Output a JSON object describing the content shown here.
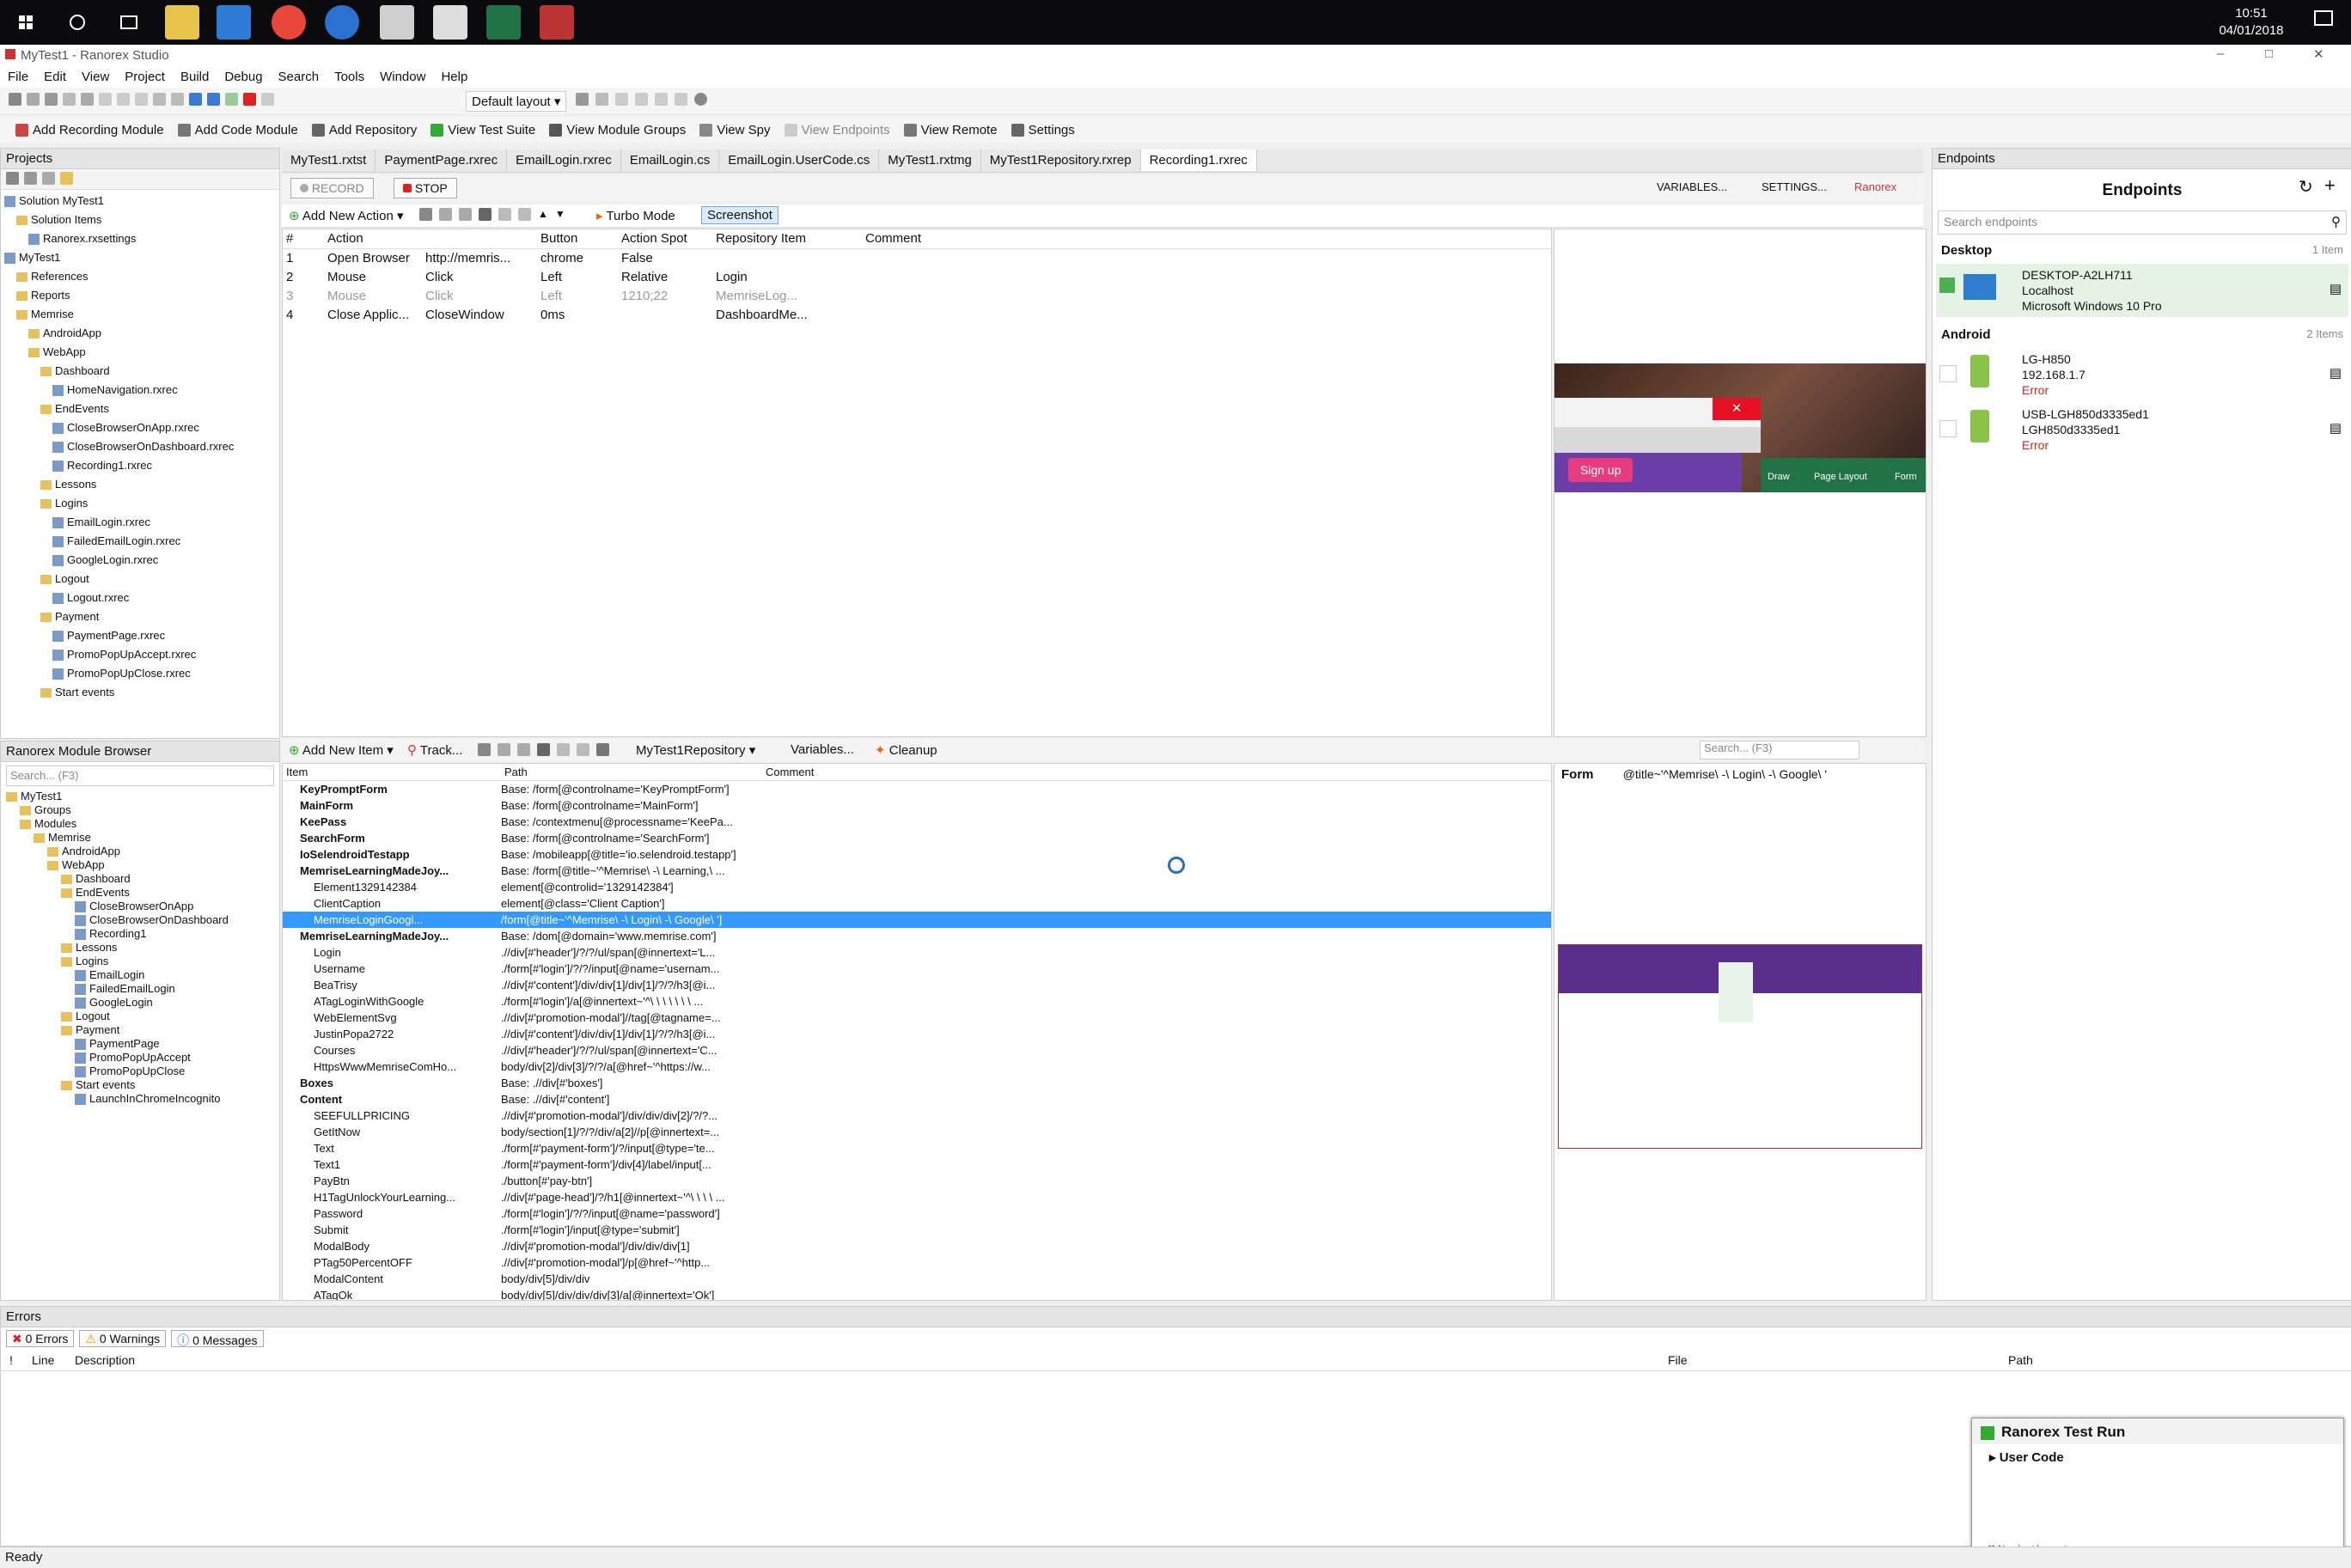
{
  "window": {
    "title": "MyTest1 - Ranorex Studio"
  },
  "taskbar": {
    "time": "10:51",
    "date": "04/01/2018"
  },
  "menu": [
    "File",
    "Edit",
    "View",
    "Project",
    "Build",
    "Debug",
    "Search",
    "Tools",
    "Window",
    "Help"
  ],
  "toolbar": {
    "layout": "Default layout"
  },
  "toolbar2": {
    "add_recording": "Add Recording Module",
    "add_code": "Add Code Module",
    "add_repo": "Add Repository",
    "view_suite": "View Test Suite",
    "view_groups": "View Module Groups",
    "view_spy": "View Spy",
    "view_endpoints": "View Endpoints",
    "view_remote": "View Remote",
    "settings": "Settings"
  },
  "projects": {
    "title": "Projects",
    "items": [
      {
        "label": "Solution MyTest1",
        "lvl": 0,
        "type": "f"
      },
      {
        "label": "Solution Items",
        "lvl": 1,
        "type": "d"
      },
      {
        "label": "Ranorex.rxsettings",
        "lvl": 2,
        "type": "f"
      },
      {
        "label": "MyTest1",
        "lvl": 0,
        "type": "f"
      },
      {
        "label": "References",
        "lvl": 1,
        "type": "d"
      },
      {
        "label": "Reports",
        "lvl": 1,
        "type": "d"
      },
      {
        "label": "Memrise",
        "lvl": 1,
        "type": "d"
      },
      {
        "label": "AndroidApp",
        "lvl": 2,
        "type": "d"
      },
      {
        "label": "WebApp",
        "lvl": 2,
        "type": "d"
      },
      {
        "label": "Dashboard",
        "lvl": 3,
        "type": "d"
      },
      {
        "label": "HomeNavigation.rxrec",
        "lvl": 4,
        "type": "f"
      },
      {
        "label": "EndEvents",
        "lvl": 3,
        "type": "d"
      },
      {
        "label": "CloseBrowserOnApp.rxrec",
        "lvl": 4,
        "type": "f"
      },
      {
        "label": "CloseBrowserOnDashboard.rxrec",
        "lvl": 4,
        "type": "f"
      },
      {
        "label": "Recording1.rxrec",
        "lvl": 4,
        "type": "f"
      },
      {
        "label": "Lessons",
        "lvl": 3,
        "type": "d"
      },
      {
        "label": "Logins",
        "lvl": 3,
        "type": "d"
      },
      {
        "label": "EmailLogin.rxrec",
        "lvl": 4,
        "type": "f"
      },
      {
        "label": "FailedEmailLogin.rxrec",
        "lvl": 4,
        "type": "f"
      },
      {
        "label": "GoogleLogin.rxrec",
        "lvl": 4,
        "type": "f"
      },
      {
        "label": "Logout",
        "lvl": 3,
        "type": "d"
      },
      {
        "label": "Logout.rxrec",
        "lvl": 4,
        "type": "f"
      },
      {
        "label": "Payment",
        "lvl": 3,
        "type": "d"
      },
      {
        "label": "PaymentPage.rxrec",
        "lvl": 4,
        "type": "f"
      },
      {
        "label": "PromoPopUpAccept.rxrec",
        "lvl": 4,
        "type": "f"
      },
      {
        "label": "PromoPopUpClose.rxrec",
        "lvl": 4,
        "type": "f"
      },
      {
        "label": "Start events",
        "lvl": 3,
        "type": "d"
      }
    ]
  },
  "editor_tabs": [
    "MyTest1.rxtst",
    "PaymentPage.rxrec",
    "EmailLogin.rxrec",
    "EmailLogin.cs",
    "EmailLogin.UserCode.cs",
    "MyTest1.rxtmg",
    "MyTest1Repository.rxrep",
    "Recording1.rxrec"
  ],
  "recorder": {
    "record": "RECORD",
    "stop": "STOP",
    "variables": "VARIABLES...",
    "settings": "SETTINGS...",
    "brand": "Ranorex",
    "add_action": "Add New Action",
    "turbo": "Turbo Mode",
    "screenshot": "Screenshot",
    "headers": [
      "#",
      "Action",
      "",
      "Button",
      "Action Spot",
      "Repository Item",
      "Comment"
    ],
    "rows": [
      [
        "1",
        "Open Browser",
        "http://memris...",
        "chrome",
        "False",
        "",
        ""
      ],
      [
        "2",
        "Mouse",
        "Click",
        "Left",
        "Relative",
        "Login",
        ""
      ],
      [
        "3",
        "Mouse",
        "Click",
        "Left",
        "1210;22",
        "MemriseLog...",
        ""
      ],
      [
        "4",
        "Close Applic...",
        "CloseWindow",
        "0ms",
        "",
        "DashboardMe...",
        ""
      ]
    ]
  },
  "preview": {
    "signup": "Sign up",
    "draw": "Draw",
    "page_layout": "Page Layout",
    "form": "Form"
  },
  "module_browser": {
    "title": "Ranorex Module Browser",
    "search": "Search... (F3)",
    "items": [
      {
        "label": "MyTest1",
        "lvl": 0
      },
      {
        "label": "Groups",
        "lvl": 1
      },
      {
        "label": "Modules",
        "lvl": 1
      },
      {
        "label": "Memrise",
        "lvl": 2
      },
      {
        "label": "AndroidApp",
        "lvl": 3
      },
      {
        "label": "WebApp",
        "lvl": 3
      },
      {
        "label": "Dashboard",
        "lvl": 4
      },
      {
        "label": "EndEvents",
        "lvl": 4
      },
      {
        "label": "CloseBrowserOnApp",
        "lvl": 5
      },
      {
        "label": "CloseBrowserOnDashboard",
        "lvl": 5
      },
      {
        "label": "Recording1",
        "lvl": 5
      },
      {
        "label": "Lessons",
        "lvl": 4
      },
      {
        "label": "Logins",
        "lvl": 4
      },
      {
        "label": "EmailLogin",
        "lvl": 5
      },
      {
        "label": "FailedEmailLogin",
        "lvl": 5
      },
      {
        "label": "GoogleLogin",
        "lvl": 5
      },
      {
        "label": "Logout",
        "lvl": 4
      },
      {
        "label": "Payment",
        "lvl": 4
      },
      {
        "label": "PaymentPage",
        "lvl": 5
      },
      {
        "label": "PromoPopUpAccept",
        "lvl": 5
      },
      {
        "label": "PromoPopUpClose",
        "lvl": 5
      },
      {
        "label": "Start events",
        "lvl": 4
      },
      {
        "label": "LaunchInChromeIncognito",
        "lvl": 5
      }
    ]
  },
  "repository": {
    "add_item": "Add New Item",
    "track": "Track...",
    "repo_name": "MyTest1Repository",
    "variables": "Variables...",
    "cleanup": "Cleanup",
    "search": "Search... (F3)",
    "headers": [
      "Item",
      "Path",
      "Comment"
    ],
    "rows": [
      [
        "KeyPromptForm",
        "Base: /form[@controlname='KeyPromptForm']"
      ],
      [
        "MainForm",
        "Base: /form[@controlname='MainForm']"
      ],
      [
        "KeePass",
        "Base: /contextmenu[@processname='KeePa..."
      ],
      [
        "SearchForm",
        "Base: /form[@controlname='SearchForm']"
      ],
      [
        "IoSelendroidTestapp",
        "Base: /mobileapp[@title='io.selendroid.testapp']"
      ],
      [
        "MemriseLearningMadeJoy...",
        "Base: /form[@title~'^Memrise\\ -\\ Learning,\\ ..."
      ],
      [
        "Element1329142384",
        "element[@controlid='1329142384']"
      ],
      [
        "ClientCaption",
        "element[@class='Client Caption']"
      ],
      [
        "MemriseLoginGoogl...",
        "/form[@title~'^Memrise\\ -\\ Login\\ -\\ Google\\ ']"
      ],
      [
        "MemriseLearningMadeJoy...",
        "Base: /dom[@domain='www.memrise.com']"
      ],
      [
        "Login",
        ".//div[#'header']/?/?/ul/span[@innertext='L..."
      ],
      [
        "Username",
        "./form[#'login']/?/?/input[@name='usernam..."
      ],
      [
        "BeaTrisy",
        ".//div[#'content']/div/div[1]/div[1]/?/?/h3[@i..."
      ],
      [
        "ATagLoginWithGoogle",
        "./form[#'login']/a[@innertext~'^\\ \\ \\ \\ \\ \\ \\ ..."
      ],
      [
        "WebElementSvg",
        ".//div[#'promotion-modal']//tag[@tagname=..."
      ],
      [
        "JustinPopa2722",
        ".//div[#'content']/div/div[1]/div[1]/?/?/h3[@i..."
      ],
      [
        "Courses",
        ".//div[#'header']/?/?/ul/span[@innertext='C..."
      ],
      [
        "HttpsWwwMemriseComHo...",
        "body/div[2]/div[3]/?/?/a[@href~'^https://w..."
      ],
      [
        "Boxes",
        "Base: .//div[#'boxes']"
      ],
      [
        "Content",
        "Base: .//div[#'content']"
      ],
      [
        "SEEFULLPRICING",
        ".//div[#'promotion-modal']/div/div/div[2]/?/?..."
      ],
      [
        "GetItNow",
        "body/section[1]/?/?/div/a[2]//p[@innertext=..."
      ],
      [
        "Text",
        "./form[#'payment-form']/?/input[@type='te..."
      ],
      [
        "Text1",
        "./form[#'payment-form']/div[4]/label/input[..."
      ],
      [
        "PayBtn",
        "./button[#'pay-btn']"
      ],
      [
        "H1TagUnlockYourLearning...",
        ".//div[#'page-head']/?/h1[@innertext~'^\\ \\ \\ \\ ..."
      ],
      [
        "Password",
        "./form[#'login']/?/?/input[@name='password']"
      ],
      [
        "Submit",
        "./form[#'login']/input[@type='submit']"
      ],
      [
        "ModalBody",
        ".//div[#'promotion-modal']/div/div/div[1]"
      ],
      [
        "PTag50PercentOFF",
        ".//div[#'promotion-modal']/p[@href~'^http..."
      ],
      [
        "ModalContent",
        "body/div[5]/div/div"
      ],
      [
        "ATagOk",
        "body/div[5]/div/div/div[3]/a[@innertext='Ok']"
      ]
    ],
    "detail_form": "Form",
    "detail_title": "@title~'^Memrise\\ -\\ Login\\ -\\ Google\\ '"
  },
  "endpoints": {
    "title": "Endpoints",
    "search": "Search endpoints",
    "desktop_label": "Desktop",
    "desktop_count": "1 Item",
    "desktop": {
      "name": "DESKTOP-A2LH711",
      "host": "Localhost",
      "os": "Microsoft Windows 10 Pro"
    },
    "android_label": "Android",
    "android_count": "2 Items",
    "android": [
      {
        "name": "LG-H850",
        "host": "192.168.1.7",
        "status": "Error"
      },
      {
        "name": "USB-LGH850d3335ed1",
        "host": "LGH850d3335ed1",
        "status": "Error"
      }
    ]
  },
  "errors": {
    "title": "Errors",
    "errors": "0 Errors",
    "warnings": "0 Warnings",
    "messages": "0 Messages",
    "headers": [
      "!",
      "Line",
      "Description",
      "File",
      "Path"
    ]
  },
  "testrun": {
    "title": "Ranorex Test Run",
    "user_code": "User Code",
    "abort": "No abort key set"
  },
  "status": "Ready"
}
